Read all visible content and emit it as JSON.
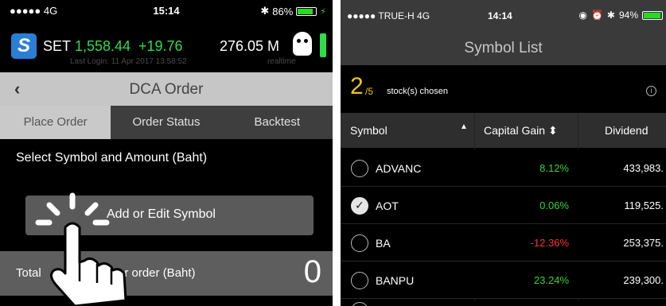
{
  "left_phone": {
    "status": {
      "signal": "●●●●● 4G",
      "time": "15:14",
      "battery": "86%",
      "battery_level": 0.86
    },
    "ticker": {
      "logo": "S",
      "index_name": "SET",
      "index_value": "1,558.44",
      "index_change": "+19.76",
      "volume": "276.05 M",
      "last_login": "Last Login: 11 Apr 2017 13:58:52",
      "realtime": "realtime"
    },
    "nav": {
      "back": "‹",
      "title": "DCA Order"
    },
    "tabs": [
      "Place Order",
      "Order Status",
      "Backtest"
    ],
    "active_tab": 0,
    "section_label": "Select Symbol and Amount (Baht)",
    "add_button_label": "Add or Edit Symbol",
    "total": {
      "label_left": "Total",
      "label_right": "er order (Baht)",
      "value": "0"
    },
    "icons": [
      "set-logo-icon",
      "mascot-icon",
      "back-chevron-icon",
      "hand-pointer-icon"
    ],
    "colors": {
      "green": "#2fdc4a",
      "logo_blue": "#2a7fd4"
    }
  },
  "right_phone": {
    "status": {
      "signal": "●●●●● TRUE-H 4G",
      "time": "14:14",
      "battery": "94%",
      "battery_level": 0.94
    },
    "title": "Symbol List",
    "chosen": {
      "count": "2",
      "total": "/5",
      "caption": "stock(s) chosen",
      "info": "i"
    },
    "table": {
      "headers": [
        "Symbol",
        "Capital Gain",
        "Dividend"
      ],
      "sort_symbol": "▲",
      "sort_gain": "⬍",
      "rows": [
        {
          "symbol": "ADVANC",
          "gain": "8.12%",
          "dividend": "433,983.",
          "checked": false,
          "trend": "pos"
        },
        {
          "symbol": "AOT",
          "gain": "0.06%",
          "dividend": "119,525.",
          "checked": true,
          "trend": "pos"
        },
        {
          "symbol": "BA",
          "gain": "-12.36%",
          "dividend": "253,375.",
          "checked": false,
          "trend": "neg"
        },
        {
          "symbol": "BANPU",
          "gain": "23.24%",
          "dividend": "239,300.",
          "checked": false,
          "trend": "pos"
        }
      ]
    },
    "colors": {
      "positive": "#33d43a",
      "negative": "#ff3030",
      "highlight": "#f0c419"
    }
  }
}
